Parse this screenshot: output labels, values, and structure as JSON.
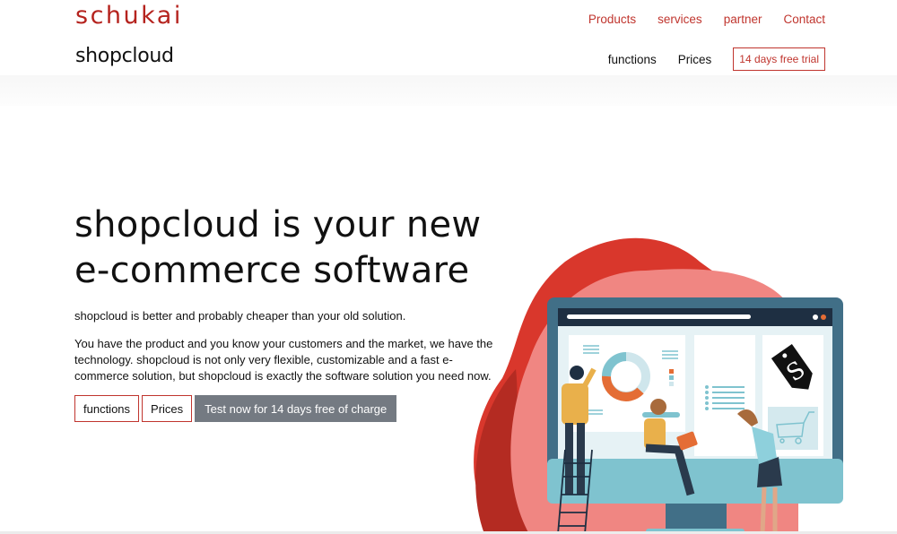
{
  "header": {
    "brand": "schukai",
    "product": "shopcloud",
    "main_nav": [
      {
        "label": "Products"
      },
      {
        "label": "services"
      },
      {
        "label": "partner"
      },
      {
        "label": "Contact"
      }
    ],
    "sub_nav": [
      {
        "label": "functions"
      },
      {
        "label": "Prices"
      }
    ],
    "trial_button": "14 days free trial"
  },
  "hero": {
    "title_line1": "shopcloud is your new",
    "title_line2": "e-commerce software",
    "lead": "shopcloud is better and probably cheaper than your old solution.",
    "body": "You have the product and you know your customers and the market, we have the technology. shopcloud is not only very flexible, customizable and a fast e-commerce solution, but shopcloud is exactly the software solution you need now.",
    "buttons": {
      "functions": "functions",
      "prices": "Prices",
      "test": "Test now for 14 days free of charge"
    }
  },
  "illustration": {
    "tag_letter": "S"
  },
  "colors": {
    "brand_red": "#b5231e",
    "link_red": "#c0352e",
    "cta_gray": "#747a82",
    "monitor_frame": "#416f87",
    "monitor_stand": "#7fc3cf"
  }
}
